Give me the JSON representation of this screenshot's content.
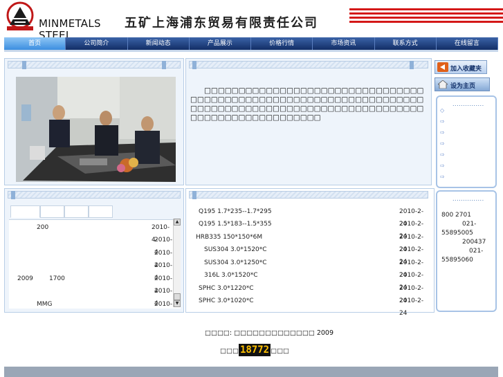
{
  "header": {
    "brand_line1": "MINMETALS",
    "brand_line2": "STEEL",
    "company_title": "五矿上海浦东贸易有限责任公司"
  },
  "nav": {
    "items": [
      "首页",
      "公司简介",
      "新闻动态",
      "产品展示",
      "价格行情",
      "市场资讯",
      "联系方式",
      "在线留言"
    ]
  },
  "buttons": {
    "favorites": "加入收藏夹",
    "homepage": "设为主页"
  },
  "intro": {
    "text": "□□□□□□□□□□□□□□□□□□□□□□□□□□□□□□□□□□□□□□□□□□□□□□□□□□□□□□□□□□□□□□□□□□□□□□□□□□□□□□□□□□□□□□□□□□□□□□□□□□□□□□□□□□□□□□□□□□□□□□□"
  },
  "side": {
    "dots": "...............",
    "contact_lines": [
      "800 2701",
      "021-",
      "55895005",
      "200437",
      "021-",
      "55895060"
    ]
  },
  "price_list": [
    {
      "a": "",
      "b": "200",
      "date": "2010-4-"
    },
    {
      "a": "",
      "b": "",
      "date": "2010-4"
    },
    {
      "a": "",
      "b": "",
      "date": "2010-4"
    },
    {
      "a": "",
      "b": "",
      "date": "2010-4"
    },
    {
      "a": "2009",
      "b": "1700",
      "date": "2010-4"
    },
    {
      "a": "",
      "b": "",
      "date": "2010-4"
    },
    {
      "a": "",
      "b": "MMG",
      "date": "2010-4"
    }
  ],
  "market_list": [
    {
      "name": "Q195 1.7*235--1.7*295",
      "date": "2010-2-24"
    },
    {
      "name": "Q195 1.5*183--1.5*355",
      "date": "2010-2-24"
    },
    {
      "name": "HRB335 150*150*6M",
      "date": "2010-2-24"
    },
    {
      "name": "SUS304 3.0*1520*C",
      "date": "2010-2-24"
    },
    {
      "name": "SUS304 3.0*1250*C",
      "date": "2010-2-24"
    },
    {
      "name": "316L 3.0*1520*C",
      "date": "2010-2-24"
    },
    {
      "name": "SPHC 3.0*1220*C",
      "date": "2010-2-24"
    },
    {
      "name": "SPHC 3.0*1020*C",
      "date": "2010-2-24"
    }
  ],
  "footer": {
    "copyright": "□□□□: □□□□□□□□□□□□□ 2009",
    "counter_prefix": "□□□",
    "counter_value": "18772",
    "counter_suffix": "□□□"
  },
  "colors": {
    "nav_dark": "#122e66",
    "nav_active": "#3c8ee0",
    "stripe_red": "#d41818",
    "panel_bg": "#eef4fb",
    "counter_digits": "#ffc000"
  }
}
